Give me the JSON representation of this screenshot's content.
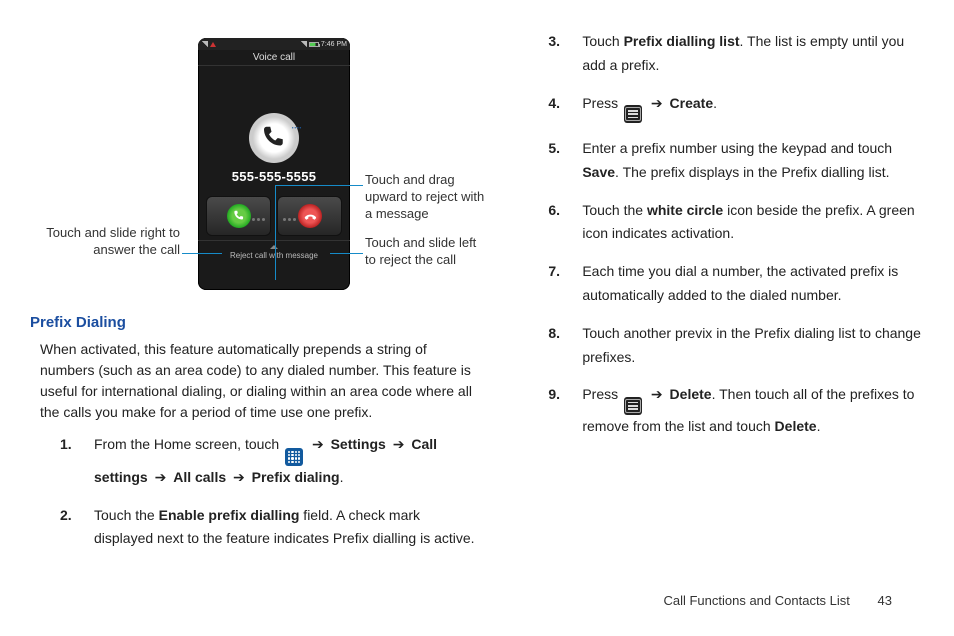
{
  "phone": {
    "status_time": "7:46 PM",
    "title": "Voice call",
    "number": "555-555-5555",
    "reject_label": "Reject call with message"
  },
  "callouts": {
    "answer": "Touch and slide right to answer the call",
    "drag_up": "Touch and drag upward to reject with a message",
    "reject": "Touch and slide left to reject the call"
  },
  "section_title": "Prefix Dialing",
  "intro": "When activated, this feature automatically prepends a string of numbers (such as an area code) to any dialed number. This feature is useful for international dialing, or dialing within an area code where all the calls you make for a period of time use one prefix.",
  "step1": {
    "a": "From the Home screen, touch ",
    "b_settings": "Settings",
    "b_callsettings": "Call settings",
    "b_allcalls": "All calls",
    "b_prefix": "Prefix dialing",
    "arrow": "➔"
  },
  "step2": {
    "a": "Touch the ",
    "b": "Enable prefix dialling",
    "c": " field. A check mark displayed next to the feature indicates Prefix dialling is active."
  },
  "step3": {
    "a": "Touch ",
    "b": "Prefix dialling list",
    "c": ". The list is empty until you add a prefix."
  },
  "step4": {
    "a": "Press ",
    "b": "Create",
    "arrow": "➔"
  },
  "step5": {
    "a": "Enter a prefix number using the keypad and touch ",
    "b": "Save",
    "c": ". The prefix displays in the Prefix dialling list."
  },
  "step6": {
    "a": "Touch the ",
    "b": "white circle",
    "c": " icon beside the prefix. A green icon indicates activation."
  },
  "step7": "Each time you dial a number, the activated prefix is automatically added to the dialed number.",
  "step8": "Touch another previx in the Prefix dialing list to change prefixes.",
  "step9": {
    "a": "Press ",
    "b": "Delete",
    "c": ". Then touch all of the prefixes to remove from the list and touch ",
    "d": "Delete",
    "e": ".",
    "arrow": "➔"
  },
  "footer": {
    "section": "Call Functions and Contacts List",
    "page": "43"
  }
}
